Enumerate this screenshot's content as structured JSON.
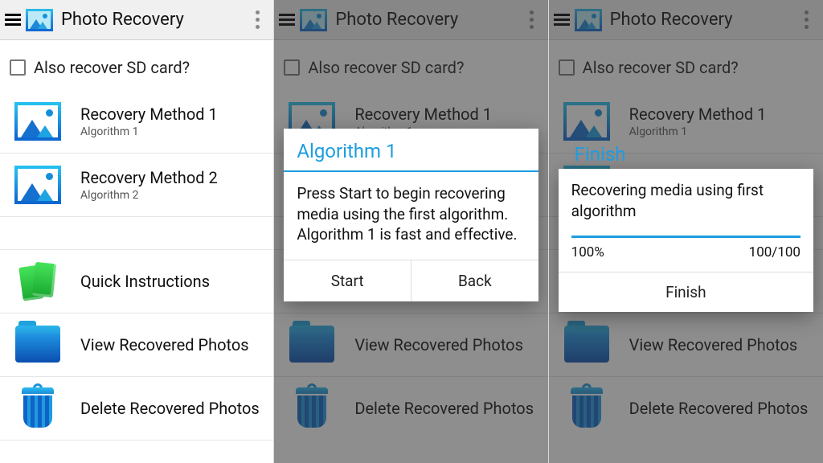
{
  "header": {
    "title": "Photo Recovery"
  },
  "sd": {
    "label": "Also recover SD card?"
  },
  "methods": [
    {
      "title": "Recovery Method 1",
      "sub": "Algorithm 1"
    },
    {
      "title": "Recovery Method 2",
      "sub": "Algorithm 2"
    }
  ],
  "actions": {
    "instructions": "Quick Instructions",
    "view": "View Recovered Photos",
    "delete": "Delete Recovered Photos"
  },
  "dialog1": {
    "title": "Algorithm 1",
    "body": "Press Start to begin recovering media using the first algorithm. Algorithm 1 is fast and effective.",
    "start": "Start",
    "back": "Back"
  },
  "dialog2": {
    "finish_header": "Finish",
    "body": "Recovering media using first algorithm",
    "percent": "100%",
    "count": "100/100",
    "finish_btn": "Finish"
  }
}
